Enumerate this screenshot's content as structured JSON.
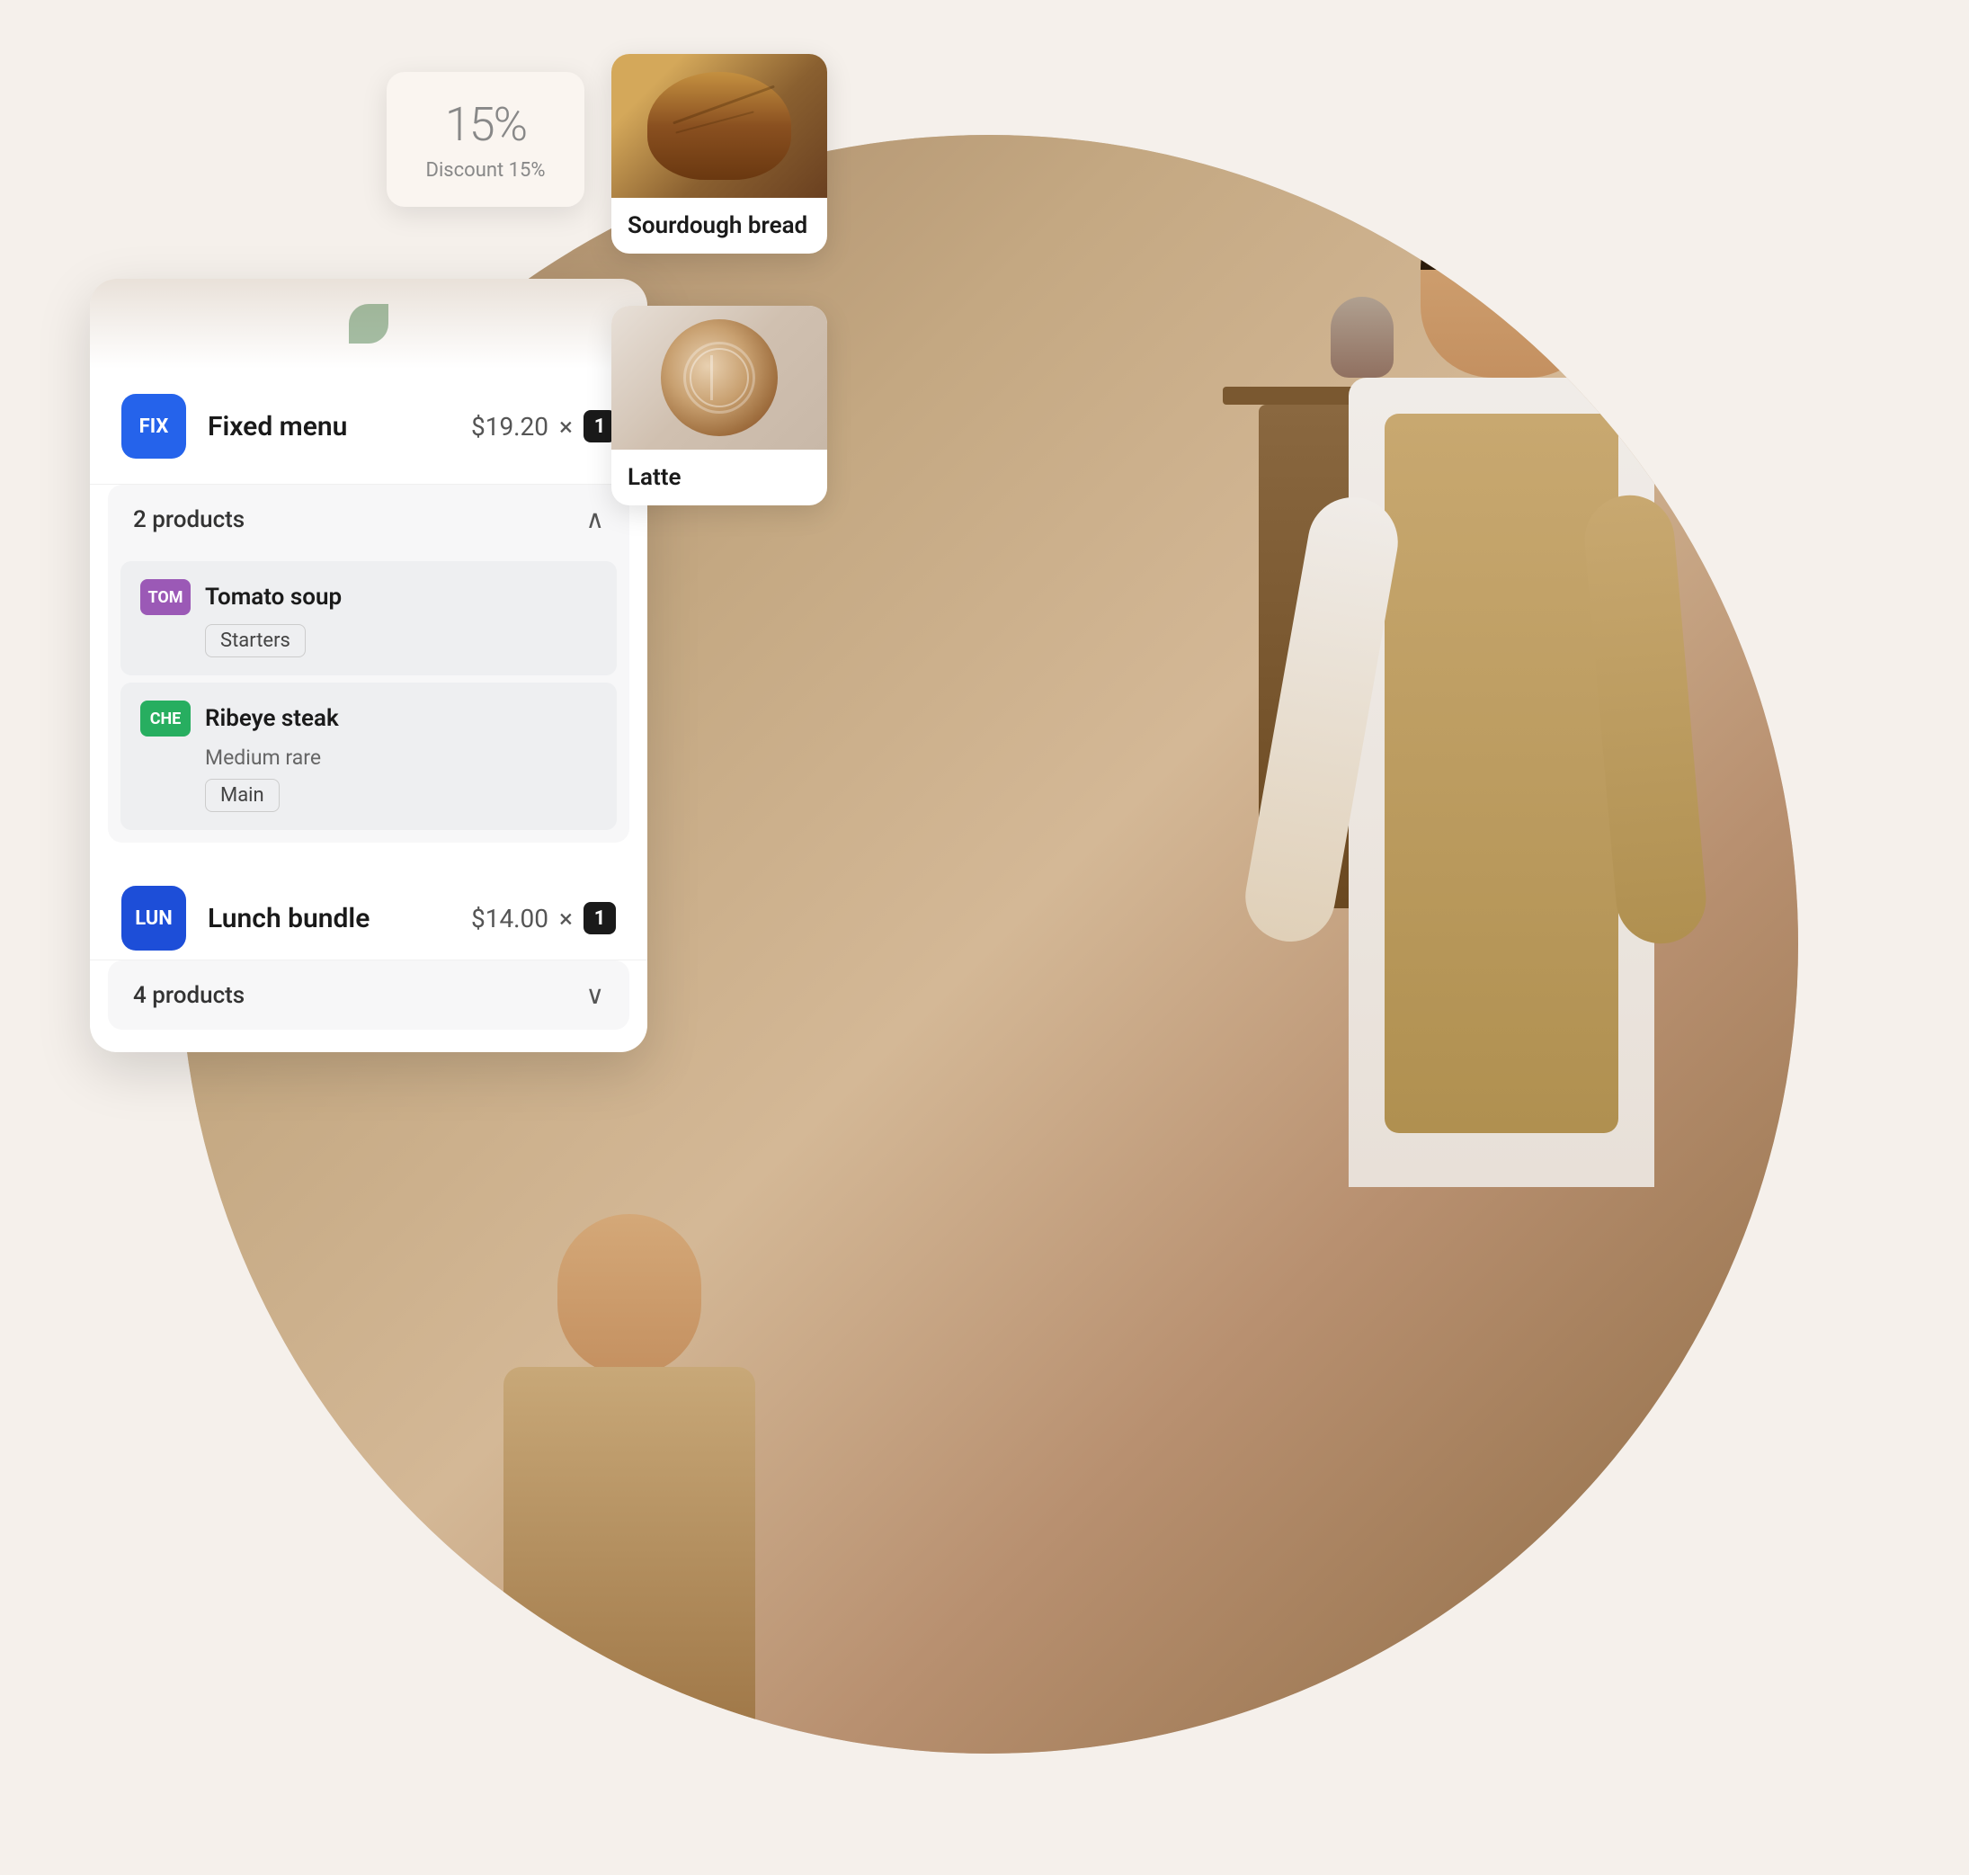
{
  "background": {
    "circle_color": "#c8b8a2"
  },
  "discount_card": {
    "percent": "15%",
    "label": "Discount 15%"
  },
  "bread_card": {
    "label": "Sourdough bread"
  },
  "latte_card": {
    "label": "Latte"
  },
  "menu_items": [
    {
      "badge": "FIX",
      "badge_color": "badge-blue",
      "name": "Fixed menu",
      "price": "$19.20",
      "qty": "1",
      "products_count": "2 products",
      "expanded": true,
      "products": [
        {
          "badge": "TOM",
          "badge_color": "badge-purple",
          "name": "Tomato soup",
          "variant": "",
          "tag": "Starters"
        },
        {
          "badge": "CHE",
          "badge_color": "badge-green",
          "name": "Ribeye steak",
          "variant": "Medium rare",
          "tag": "Main"
        }
      ]
    },
    {
      "badge": "LUN",
      "badge_color": "badge-blue2",
      "name": "Lunch bundle",
      "price": "$14.00",
      "qty": "1",
      "products_count": "4 products",
      "expanded": false,
      "products": []
    }
  ],
  "icons": {
    "chevron_up": "∧",
    "chevron_down": "∨",
    "leaf": "🌿",
    "multiply": "×"
  }
}
